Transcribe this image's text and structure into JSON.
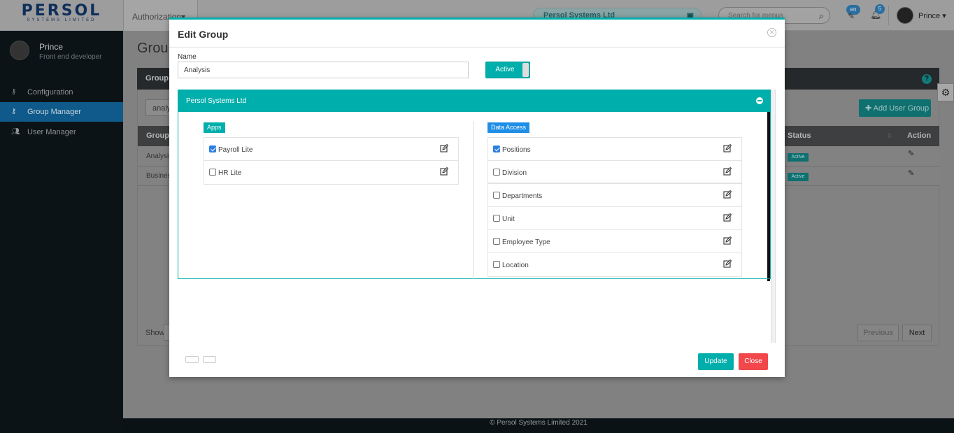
{
  "topbar": {
    "logo_text": "PERSOL",
    "logo_sub": "SYSTEMS LIMITED",
    "menu_label": "Authorization",
    "company": "Persol Systems Ltd",
    "search_placeholder": "Search for menus",
    "language": "en",
    "notification_count": "5",
    "user_name": "Prince"
  },
  "sidebar": {
    "user_name": "Prince",
    "user_role": "Front end developer",
    "items": [
      {
        "label": "Configuration",
        "icon": "key-icon"
      },
      {
        "label": "Group Manager",
        "icon": "key-icon",
        "active": true
      },
      {
        "label": "User Manager",
        "icon": "users-icon"
      }
    ]
  },
  "page": {
    "title": "Grou",
    "card_title": "Group N",
    "filter_value": "analy",
    "add_button": "Add User Group",
    "columns": {
      "groups": "Groups",
      "status": "Status",
      "action": "Action"
    },
    "rows": [
      {
        "group": "Analysis",
        "status": "Active"
      },
      {
        "group": "Business",
        "status": "Active"
      }
    ],
    "show_label": "Show",
    "prev_label": "Previous",
    "next_label": "Next"
  },
  "footer": {
    "text": "© Persol Systems Limited 2021"
  },
  "modal": {
    "title": "Edit Group",
    "name_label": "Name",
    "name_value": "Analysis",
    "status_toggle": "Active",
    "company_panel": "Persol Systems Ltd",
    "apps_label": "Apps",
    "apps": [
      {
        "label": "Payroll Lite",
        "checked": true
      },
      {
        "label": "HR Lite",
        "checked": false
      }
    ],
    "data_access_label": "Data Access",
    "data_access": [
      {
        "label": "Positions",
        "checked": true
      },
      {
        "label": "Division",
        "checked": false
      },
      {
        "label": "Departments",
        "checked": false
      },
      {
        "label": "Unit",
        "checked": false
      },
      {
        "label": "Employee Type",
        "checked": false
      },
      {
        "label": "Location",
        "checked": false
      }
    ],
    "update_button": "Update",
    "close_button": "Close"
  },
  "colors": {
    "accent": "#00aeab",
    "danger": "#f2474b",
    "checkbox": "#2c7fe0",
    "sidebar_active": "#0f5a8a",
    "data_access_tag": "#1f8ee6"
  }
}
